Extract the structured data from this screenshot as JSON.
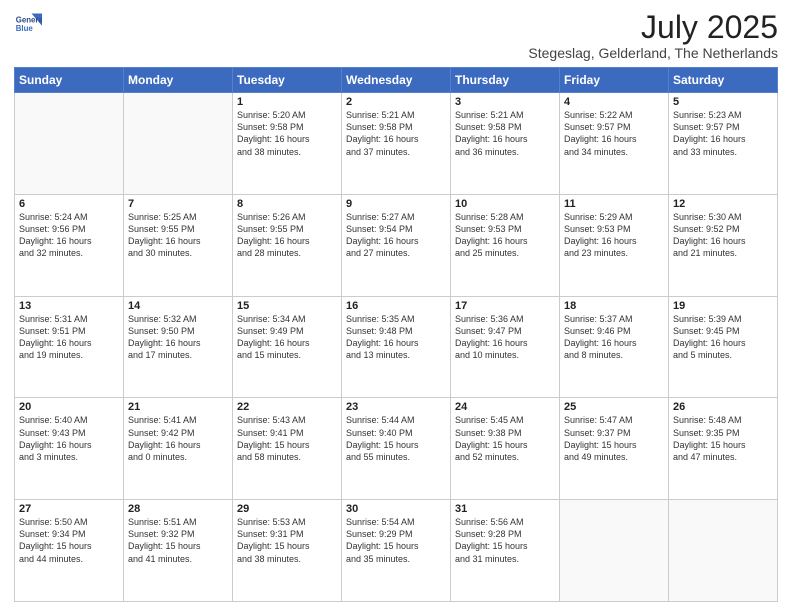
{
  "header": {
    "logo_line1": "General",
    "logo_line2": "Blue",
    "title": "July 2025",
    "subtitle": "Stegeslag, Gelderland, The Netherlands"
  },
  "days_of_week": [
    "Sunday",
    "Monday",
    "Tuesday",
    "Wednesday",
    "Thursday",
    "Friday",
    "Saturday"
  ],
  "weeks": [
    [
      {
        "day": "",
        "info": ""
      },
      {
        "day": "",
        "info": ""
      },
      {
        "day": "1",
        "info": "Sunrise: 5:20 AM\nSunset: 9:58 PM\nDaylight: 16 hours\nand 38 minutes."
      },
      {
        "day": "2",
        "info": "Sunrise: 5:21 AM\nSunset: 9:58 PM\nDaylight: 16 hours\nand 37 minutes."
      },
      {
        "day": "3",
        "info": "Sunrise: 5:21 AM\nSunset: 9:58 PM\nDaylight: 16 hours\nand 36 minutes."
      },
      {
        "day": "4",
        "info": "Sunrise: 5:22 AM\nSunset: 9:57 PM\nDaylight: 16 hours\nand 34 minutes."
      },
      {
        "day": "5",
        "info": "Sunrise: 5:23 AM\nSunset: 9:57 PM\nDaylight: 16 hours\nand 33 minutes."
      }
    ],
    [
      {
        "day": "6",
        "info": "Sunrise: 5:24 AM\nSunset: 9:56 PM\nDaylight: 16 hours\nand 32 minutes."
      },
      {
        "day": "7",
        "info": "Sunrise: 5:25 AM\nSunset: 9:55 PM\nDaylight: 16 hours\nand 30 minutes."
      },
      {
        "day": "8",
        "info": "Sunrise: 5:26 AM\nSunset: 9:55 PM\nDaylight: 16 hours\nand 28 minutes."
      },
      {
        "day": "9",
        "info": "Sunrise: 5:27 AM\nSunset: 9:54 PM\nDaylight: 16 hours\nand 27 minutes."
      },
      {
        "day": "10",
        "info": "Sunrise: 5:28 AM\nSunset: 9:53 PM\nDaylight: 16 hours\nand 25 minutes."
      },
      {
        "day": "11",
        "info": "Sunrise: 5:29 AM\nSunset: 9:53 PM\nDaylight: 16 hours\nand 23 minutes."
      },
      {
        "day": "12",
        "info": "Sunrise: 5:30 AM\nSunset: 9:52 PM\nDaylight: 16 hours\nand 21 minutes."
      }
    ],
    [
      {
        "day": "13",
        "info": "Sunrise: 5:31 AM\nSunset: 9:51 PM\nDaylight: 16 hours\nand 19 minutes."
      },
      {
        "day": "14",
        "info": "Sunrise: 5:32 AM\nSunset: 9:50 PM\nDaylight: 16 hours\nand 17 minutes."
      },
      {
        "day": "15",
        "info": "Sunrise: 5:34 AM\nSunset: 9:49 PM\nDaylight: 16 hours\nand 15 minutes."
      },
      {
        "day": "16",
        "info": "Sunrise: 5:35 AM\nSunset: 9:48 PM\nDaylight: 16 hours\nand 13 minutes."
      },
      {
        "day": "17",
        "info": "Sunrise: 5:36 AM\nSunset: 9:47 PM\nDaylight: 16 hours\nand 10 minutes."
      },
      {
        "day": "18",
        "info": "Sunrise: 5:37 AM\nSunset: 9:46 PM\nDaylight: 16 hours\nand 8 minutes."
      },
      {
        "day": "19",
        "info": "Sunrise: 5:39 AM\nSunset: 9:45 PM\nDaylight: 16 hours\nand 5 minutes."
      }
    ],
    [
      {
        "day": "20",
        "info": "Sunrise: 5:40 AM\nSunset: 9:43 PM\nDaylight: 16 hours\nand 3 minutes."
      },
      {
        "day": "21",
        "info": "Sunrise: 5:41 AM\nSunset: 9:42 PM\nDaylight: 16 hours\nand 0 minutes."
      },
      {
        "day": "22",
        "info": "Sunrise: 5:43 AM\nSunset: 9:41 PM\nDaylight: 15 hours\nand 58 minutes."
      },
      {
        "day": "23",
        "info": "Sunrise: 5:44 AM\nSunset: 9:40 PM\nDaylight: 15 hours\nand 55 minutes."
      },
      {
        "day": "24",
        "info": "Sunrise: 5:45 AM\nSunset: 9:38 PM\nDaylight: 15 hours\nand 52 minutes."
      },
      {
        "day": "25",
        "info": "Sunrise: 5:47 AM\nSunset: 9:37 PM\nDaylight: 15 hours\nand 49 minutes."
      },
      {
        "day": "26",
        "info": "Sunrise: 5:48 AM\nSunset: 9:35 PM\nDaylight: 15 hours\nand 47 minutes."
      }
    ],
    [
      {
        "day": "27",
        "info": "Sunrise: 5:50 AM\nSunset: 9:34 PM\nDaylight: 15 hours\nand 44 minutes."
      },
      {
        "day": "28",
        "info": "Sunrise: 5:51 AM\nSunset: 9:32 PM\nDaylight: 15 hours\nand 41 minutes."
      },
      {
        "day": "29",
        "info": "Sunrise: 5:53 AM\nSunset: 9:31 PM\nDaylight: 15 hours\nand 38 minutes."
      },
      {
        "day": "30",
        "info": "Sunrise: 5:54 AM\nSunset: 9:29 PM\nDaylight: 15 hours\nand 35 minutes."
      },
      {
        "day": "31",
        "info": "Sunrise: 5:56 AM\nSunset: 9:28 PM\nDaylight: 15 hours\nand 31 minutes."
      },
      {
        "day": "",
        "info": ""
      },
      {
        "day": "",
        "info": ""
      }
    ]
  ]
}
